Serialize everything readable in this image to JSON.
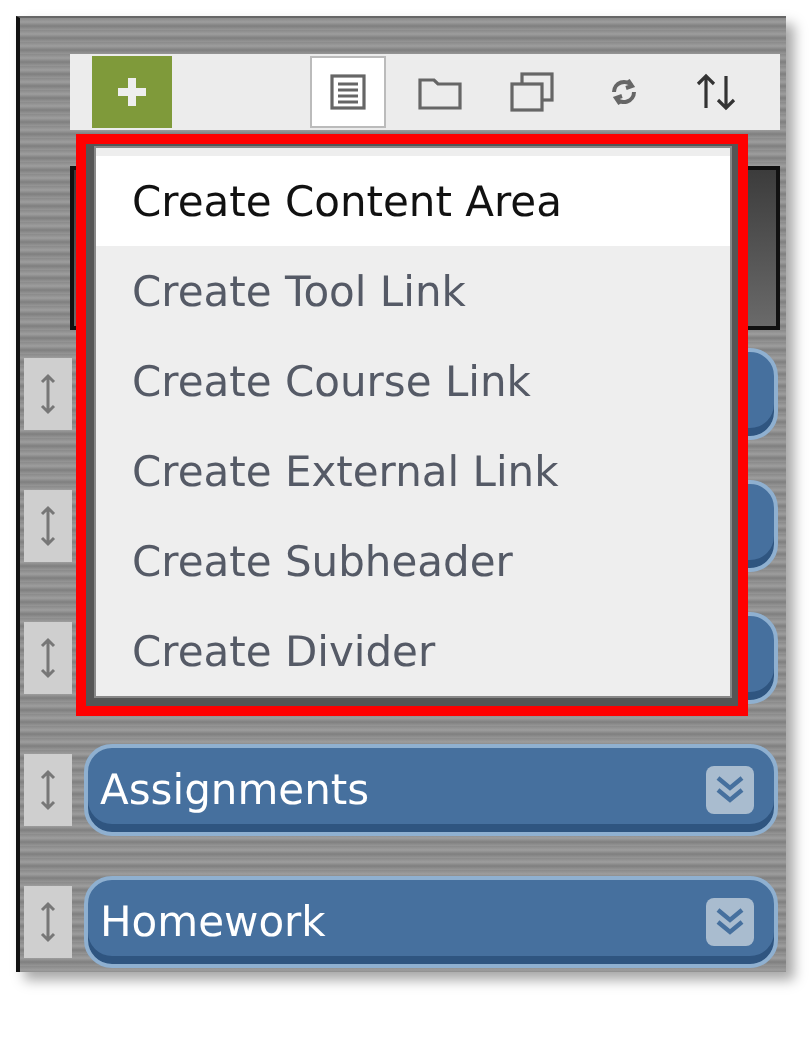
{
  "toolbar": {
    "tools": [
      {
        "kind": "list",
        "selected": true
      },
      {
        "kind": "folder",
        "selected": false
      },
      {
        "kind": "windows",
        "selected": false
      },
      {
        "kind": "refresh",
        "selected": false
      },
      {
        "kind": "sort",
        "selected": false
      }
    ]
  },
  "menu": {
    "items": [
      {
        "label": "Create Content Area",
        "selected": true
      },
      {
        "label": "Create Tool Link",
        "selected": false
      },
      {
        "label": "Create Course Link",
        "selected": false
      },
      {
        "label": "Create External Link",
        "selected": false
      },
      {
        "label": "Create Subheader",
        "selected": false
      },
      {
        "label": "Create Divider",
        "selected": false
      }
    ]
  },
  "course_menu": [
    {
      "kind": "covered"
    },
    {
      "kind": "covered"
    },
    {
      "kind": "covered"
    },
    {
      "kind": "link",
      "label": "Assignments"
    },
    {
      "kind": "link",
      "label": "Homework"
    }
  ]
}
